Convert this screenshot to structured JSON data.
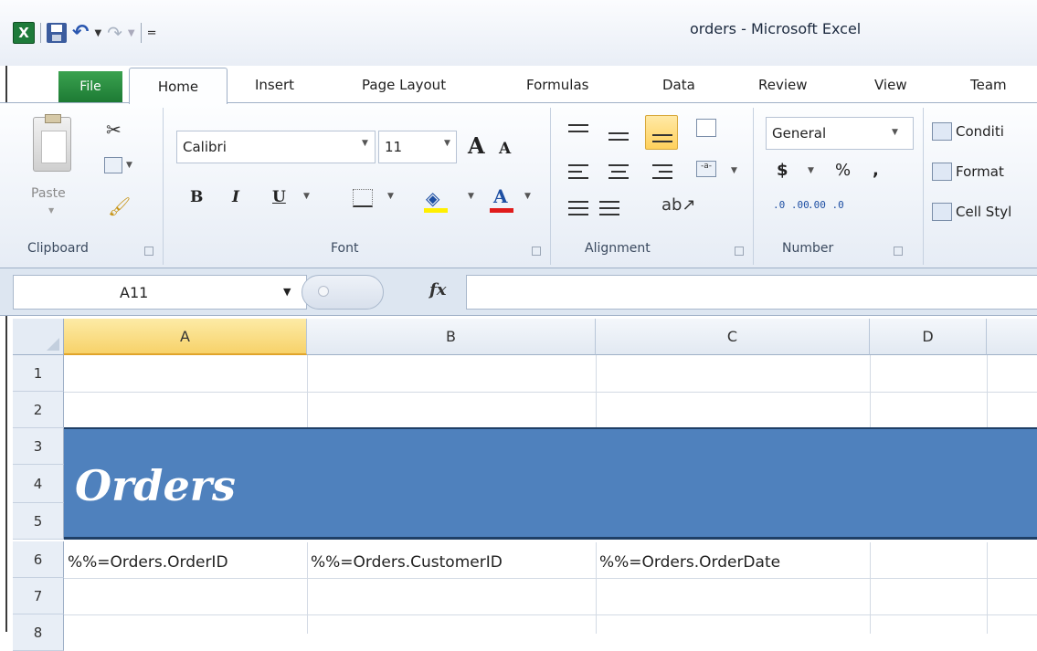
{
  "window": {
    "title": "orders - Microsoft Excel"
  },
  "qat": {
    "app_icon": "excel-logo",
    "customize": "="
  },
  "tabs": {
    "file": "File",
    "home": "Home",
    "insert": "Insert",
    "page_layout": "Page Layout",
    "formulas": "Formulas",
    "data": "Data",
    "review": "Review",
    "view": "View",
    "team": "Team"
  },
  "ribbon": {
    "clipboard": {
      "label": "Clipboard",
      "paste": "Paste"
    },
    "font": {
      "label": "Font",
      "name": "Calibri",
      "size": "11",
      "bold": "B",
      "italic": "I",
      "underline": "U",
      "grow": "A",
      "shrink": "A",
      "color": "A"
    },
    "alignment": {
      "label": "Alignment"
    },
    "number": {
      "label": "Number",
      "format": "General",
      "currency": "$",
      "percent": "%",
      "comma": ",",
      "inc_decimal": ".0 .00",
      "dec_decimal": ".00 .0"
    },
    "styles": {
      "conditional": "Conditi",
      "format_table": "Format",
      "cell_styles": "Cell Styl"
    }
  },
  "formula_bar": {
    "name_box": "A11",
    "fx": "fx",
    "value": ""
  },
  "sheet": {
    "columns": [
      "A",
      "B",
      "C",
      "D"
    ],
    "rows": [
      "1",
      "2",
      "3",
      "4",
      "5",
      "6",
      "7",
      "8"
    ],
    "banner_title": "Orders",
    "row6": [
      "%%=Orders.OrderID",
      "%%=Orders.CustomerID",
      "%%=Orders.OrderDate"
    ],
    "banner_color": "#4f81bd",
    "selected_column": "A"
  }
}
